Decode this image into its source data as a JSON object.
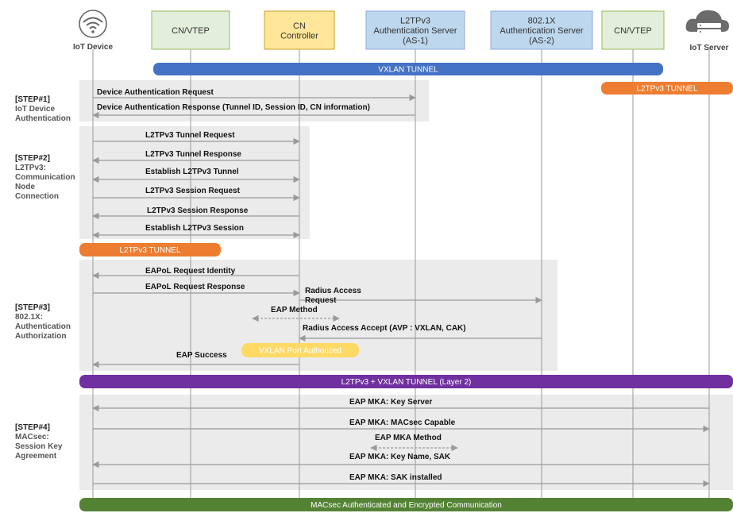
{
  "participants": [
    {
      "id": "iot",
      "label": "IoT Device"
    },
    {
      "id": "cn1",
      "label": "CN/VTEP"
    },
    {
      "id": "ctrl",
      "label": "CN\nController"
    },
    {
      "id": "as1",
      "label": "L2TPv3\nAuthentication Server\n(AS-1)"
    },
    {
      "id": "as2",
      "label": "802.1X\nAuthentication Server\n(AS-2)"
    },
    {
      "id": "cn2",
      "label": "CN/VTEP"
    },
    {
      "id": "srv",
      "label": "IoT Server"
    }
  ],
  "colors": {
    "blue": "#4472c4",
    "orange": "#ed7d31",
    "purple": "#7030a0",
    "green": "#548235",
    "yellow": "#ffd966",
    "lifeline": "#9a9a9a",
    "box_green": "#e2efda",
    "box_yellow": "#ffe699",
    "box_blue": "#bdd7ee",
    "step_bg": "#ebebeb"
  },
  "bands": [
    {
      "id": "vxlan-tunnel",
      "label": "VXLAN TUNNEL",
      "color": "blue"
    },
    {
      "id": "l2tpv3-tunnel-top",
      "label": "L2TPv3 TUNNEL",
      "color": "orange"
    },
    {
      "id": "l2tpv3-tunnel-mid",
      "label": "L2TPv3 TUNNEL",
      "color": "orange"
    },
    {
      "id": "vxlan-port-authorized",
      "label": "VXLAN Port Authorized",
      "color": "yellow"
    },
    {
      "id": "l2tpv3-vxlan-tunnel",
      "label": "L2TPv3 + VXLAN TUNNEL (Layer 2)",
      "color": "purple"
    },
    {
      "id": "macsec-comm",
      "label": "MACsec Authenticated and Encrypted Communication",
      "color": "green"
    }
  ],
  "steps": [
    {
      "id": "step1",
      "title": "[STEP#1]",
      "desc": "IoT Device\nAuthentication"
    },
    {
      "id": "step2",
      "title": "[STEP#2]",
      "desc": "L2TPv3:\nCommunication\nNode\nConnection"
    },
    {
      "id": "step3",
      "title": "[STEP#3]",
      "desc": "802.1X:\nAuthentication\nAuthorization"
    },
    {
      "id": "step4",
      "title": "[STEP#4]",
      "desc": "MACsec:\nSession Key\nAgreement"
    }
  ],
  "messages": [
    {
      "id": "m1",
      "label": "Device Authentication Request",
      "from": "iot",
      "to": "as1",
      "style": "solid"
    },
    {
      "id": "m2",
      "label": "Device Authentication Response (Tunnel ID, Session ID, CN information)",
      "from": "as1",
      "to": "iot",
      "style": "solid"
    },
    {
      "id": "m3",
      "label": "L2TPv3 Tunnel Request",
      "from": "iot",
      "to": "ctrl",
      "style": "solid"
    },
    {
      "id": "m4",
      "label": "L2TPv3 Tunnel Response",
      "from": "ctrl",
      "to": "iot",
      "style": "solid"
    },
    {
      "id": "m5",
      "label": "Establish L2TPv3 Tunnel",
      "from": "iot",
      "to": "ctrl",
      "style": "both"
    },
    {
      "id": "m6",
      "label": "L2TPv3 Session Request",
      "from": "iot",
      "to": "ctrl",
      "style": "solid"
    },
    {
      "id": "m7",
      "label": "L2TPv3 Session Response",
      "from": "ctrl",
      "to": "iot",
      "style": "solid"
    },
    {
      "id": "m8",
      "label": "Establish L2TPv3 Session",
      "from": "iot",
      "to": "ctrl",
      "style": "both"
    },
    {
      "id": "m9",
      "label": "EAPoL Request Identity",
      "from": "ctrl",
      "to": "iot",
      "style": "solid"
    },
    {
      "id": "m10",
      "label": "EAPoL Request Response",
      "from": "iot",
      "to": "ctrl",
      "style": "solid"
    },
    {
      "id": "m11",
      "label": "Radius Access\nRequest",
      "from": "ctrl",
      "to": "as2",
      "style": "solid"
    },
    {
      "id": "m12",
      "label": "EAP Method",
      "from": "ctrl",
      "to": "as2",
      "style": "dashed"
    },
    {
      "id": "m13",
      "label": "Radius Access Accept (AVP : VXLAN, CAK)",
      "from": "as2",
      "to": "ctrl",
      "style": "solid"
    },
    {
      "id": "m14",
      "label": "EAP Success",
      "from": "ctrl",
      "to": "iot",
      "style": "solid"
    },
    {
      "id": "m15",
      "label": "EAP MKA: Key Server",
      "from": "srv",
      "to": "iot",
      "style": "solid"
    },
    {
      "id": "m16",
      "label": "EAP MKA: MACsec Capable",
      "from": "iot",
      "to": "srv",
      "style": "solid"
    },
    {
      "id": "m17",
      "label": "EAP MKA Method",
      "from": "ctrl",
      "to": "as2",
      "style": "dashed"
    },
    {
      "id": "m18",
      "label": "EAP MKA: Key Name, SAK",
      "from": "srv",
      "to": "iot",
      "style": "solid"
    },
    {
      "id": "m19",
      "label": "EAP MKA: SAK installed",
      "from": "iot",
      "to": "srv",
      "style": "solid"
    }
  ]
}
